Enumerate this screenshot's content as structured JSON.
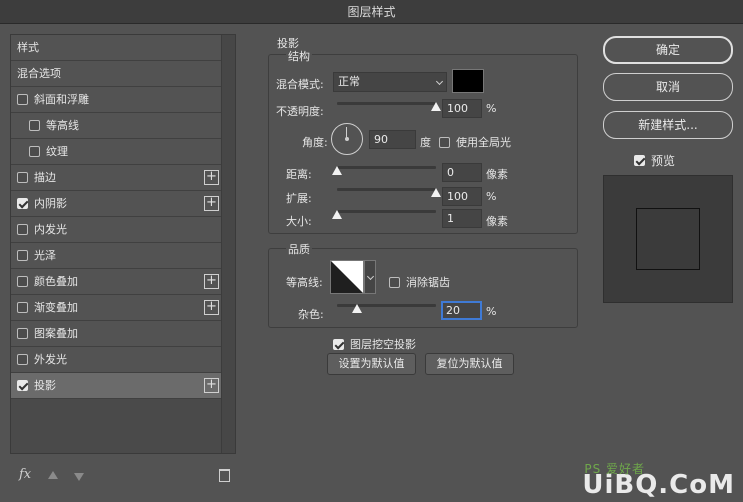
{
  "window": {
    "title": "图层样式"
  },
  "left_panel": {
    "items": [
      {
        "label": "样式",
        "type": "header",
        "checked": null,
        "plus": false,
        "selected": false
      },
      {
        "label": "混合选项",
        "type": "header",
        "checked": null,
        "plus": false,
        "selected": false
      },
      {
        "label": "斜面和浮雕",
        "type": "item",
        "checked": false,
        "plus": false,
        "selected": false
      },
      {
        "label": "等高线",
        "type": "sub",
        "checked": false,
        "plus": false,
        "selected": false
      },
      {
        "label": "纹理",
        "type": "sub",
        "checked": false,
        "plus": false,
        "selected": false
      },
      {
        "label": "描边",
        "type": "item",
        "checked": false,
        "plus": true,
        "selected": false
      },
      {
        "label": "内阴影",
        "type": "item",
        "checked": true,
        "plus": true,
        "selected": false
      },
      {
        "label": "内发光",
        "type": "item",
        "checked": false,
        "plus": false,
        "selected": false
      },
      {
        "label": "光泽",
        "type": "item",
        "checked": false,
        "plus": false,
        "selected": false
      },
      {
        "label": "颜色叠加",
        "type": "item",
        "checked": false,
        "plus": true,
        "selected": false
      },
      {
        "label": "渐变叠加",
        "type": "item",
        "checked": false,
        "plus": true,
        "selected": false
      },
      {
        "label": "图案叠加",
        "type": "item",
        "checked": false,
        "plus": false,
        "selected": false
      },
      {
        "label": "外发光",
        "type": "item",
        "checked": false,
        "plus": false,
        "selected": false
      },
      {
        "label": "投影",
        "type": "item",
        "checked": true,
        "plus": true,
        "selected": true
      }
    ],
    "footer": {
      "fx_label": "fx"
    }
  },
  "drop_shadow": {
    "section_title": "投影",
    "structure": {
      "title": "结构",
      "blend_mode_label": "混合模式:",
      "blend_mode_value": "正常",
      "shadow_color": "#000000",
      "opacity_label": "不透明度:",
      "opacity_value": "100",
      "opacity_level": 1.0,
      "angle_label": "角度:",
      "angle_value": "90",
      "angle_unit": "度",
      "global_light_label": "使用全局光",
      "global_light_checked": false,
      "distance_label": "距离:",
      "distance_value": "0",
      "distance_level": 0.0,
      "spread_label": "扩展:",
      "spread_value": "100",
      "spread_level": 1.0,
      "size_label": "大小:",
      "size_value": "1",
      "size_level": 0.0,
      "percent_unit": "%",
      "pixel_unit": "像素"
    },
    "quality": {
      "title": "品质",
      "contour_label": "等高线:",
      "anti_alias_label": "消除锯齿",
      "anti_alias_checked": false,
      "noise_label": "杂色:",
      "noise_value": "20",
      "noise_level": 0.2,
      "percent_unit": "%"
    },
    "knockout_label": "图层挖空投影",
    "knockout_checked": true,
    "make_default_label": "设置为默认值",
    "reset_default_label": "复位为默认值"
  },
  "right_panel": {
    "ok_label": "确定",
    "cancel_label": "取消",
    "new_style_label": "新建样式...",
    "preview_label": "预览",
    "preview_checked": true
  },
  "watermark": {
    "text": "UiBQ.CoM",
    "small_text": "PS 爱好者"
  }
}
